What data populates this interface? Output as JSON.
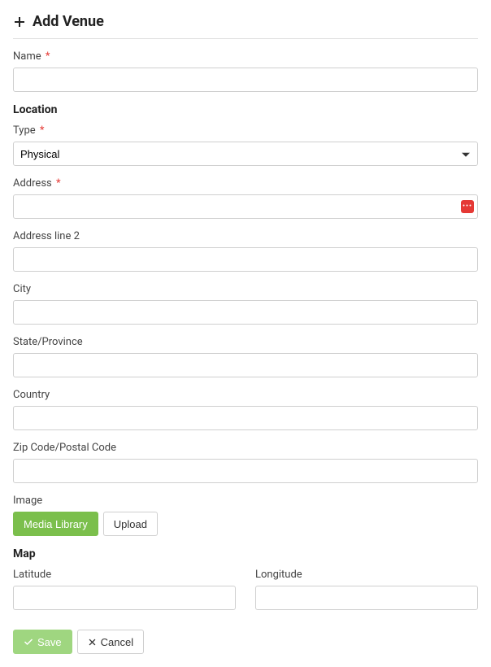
{
  "header": {
    "title": "Add Venue"
  },
  "fields": {
    "name": {
      "label": "Name",
      "required": true,
      "value": ""
    }
  },
  "location": {
    "section_title": "Location",
    "type": {
      "label": "Type",
      "required": true,
      "value": "Physical"
    },
    "address": {
      "label": "Address",
      "required": true,
      "value": ""
    },
    "address2": {
      "label": "Address line 2",
      "value": ""
    },
    "city": {
      "label": "City",
      "value": ""
    },
    "state": {
      "label": "State/Province",
      "value": ""
    },
    "country": {
      "label": "Country",
      "value": ""
    },
    "zip": {
      "label": "Zip Code/Postal Code",
      "value": ""
    }
  },
  "image": {
    "label": "Image",
    "media_library_label": "Media Library",
    "upload_label": "Upload"
  },
  "map": {
    "section_title": "Map",
    "latitude": {
      "label": "Latitude",
      "value": ""
    },
    "longitude": {
      "label": "Longitude",
      "value": ""
    }
  },
  "actions": {
    "save_label": "Save",
    "cancel_label": "Cancel"
  }
}
